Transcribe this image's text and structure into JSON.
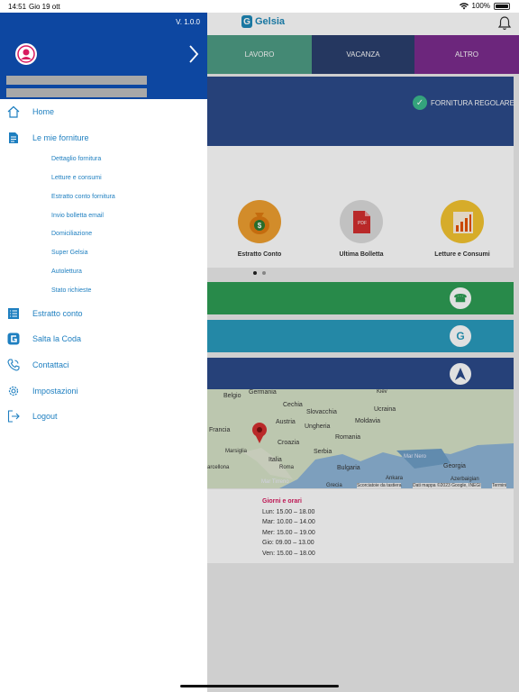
{
  "status_bar": {
    "time": "14:51",
    "date": "Gio 19 ott",
    "battery": "100%"
  },
  "app": {
    "logo_text": "Gelsia",
    "tabs": [
      {
        "label": "LAVORO",
        "color": "#4e9c84"
      },
      {
        "label": "VACANZA",
        "color": "#2b3f6e"
      },
      {
        "label": "ALTRO",
        "color": "#7b2c8e"
      }
    ],
    "supply_status": "FORNITURA REGOLARE",
    "quick_actions": [
      {
        "label": "Estratto Conto",
        "icon": "money-bag-icon"
      },
      {
        "label": "Ultima Bolletta",
        "icon": "pdf-icon"
      },
      {
        "label": "Letture e Consumi",
        "icon": "chart-icon"
      }
    ],
    "pager": {
      "pages": 2,
      "active": 1
    },
    "bars": [
      {
        "icon": "phone-icon",
        "color": "#2e9e55"
      },
      {
        "icon": "gelsia-logo-icon",
        "color": "#2a9bbd"
      },
      {
        "icon": "navigation-icon",
        "color": "#2c4a8a"
      }
    ],
    "map_labels": [
      "Germania",
      "Belgio",
      "Cechia",
      "Kiev",
      "Slovacchia",
      "Ucraina",
      "Austria",
      "Moldavia",
      "Francia",
      "Ungheria",
      "Croazia",
      "Romania",
      "Marsiglia",
      "Serbia",
      "Mar Nero",
      "Italia",
      "Roma",
      "Bulgaria",
      "Georgia",
      "arcellona",
      "Mar Tirreno",
      "Ankara",
      "Azerbaigian",
      "Grecia",
      "Scorciatoie da tastiera",
      "Dati mappa ©2023 Google, INEGI",
      "Termini"
    ],
    "hours": {
      "title": "Giorni e orari",
      "lines": [
        "Lun: 15.00 – 18.00",
        "Mar: 10.00 – 14.00",
        "Mer: 15.00 – 19.00",
        "Gio:  09.00 – 13.00",
        "Ven: 15.00 – 18.00"
      ]
    }
  },
  "drawer": {
    "version": "V. 1.0.0",
    "menu": [
      {
        "label": "Home",
        "icon": "home-icon"
      },
      {
        "label": "Le mie forniture",
        "icon": "document-icon"
      }
    ],
    "submenu": [
      "Dettaglio fornitura",
      "Letture e consumi",
      "Estratto conto fornitura",
      "Invio bolletta email",
      "Domiciliazione",
      "Super Gelsia",
      "Autolettura",
      "Stato richieste"
    ],
    "menu_bottom": [
      {
        "label": "Estratto conto",
        "icon": "list-icon"
      },
      {
        "label": "Salta la Coda",
        "icon": "gelsia-g-icon"
      },
      {
        "label": "Contattaci",
        "icon": "phone-icon"
      },
      {
        "label": "Impostazioni",
        "icon": "gear-icon"
      },
      {
        "label": "Logout",
        "icon": "logout-icon"
      }
    ]
  }
}
